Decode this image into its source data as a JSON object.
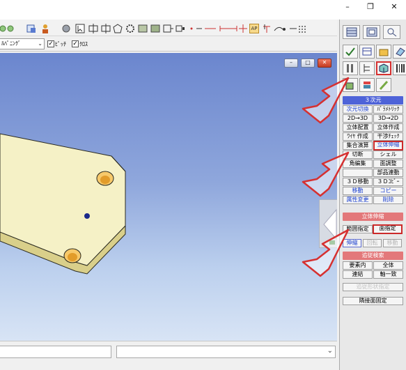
{
  "window": {
    "minimize": "–",
    "restore": "❐",
    "close": "✕"
  },
  "optionbar": {
    "combo_value": "ﾙﾊﾟﾆﾝｸﾞ",
    "check1_label": "ﾋﾟｯﾁ",
    "check2_label": "ｸﾛｽ"
  },
  "toolbar": {
    "ap_label": "AP"
  },
  "viewport": {
    "min_label": "–",
    "max_label": "□",
    "close_label": "✕"
  },
  "panel": {
    "section_3d": "３次元",
    "cmds_3d": [
      [
        "次元切換",
        "ﾊﾟﾗﾒﾄﾘｯｸ"
      ],
      [
        "2D→3D",
        "3D→2D"
      ],
      [
        "立体配置",
        "立体作成"
      ],
      [
        "ﾜｲﾔ 作成",
        "干渉ﾁｪｯｸ"
      ],
      [
        "集合演算",
        "立体伸縮"
      ],
      [
        "切断",
        "シェル"
      ],
      [
        "角編集",
        "面調整"
      ],
      [
        "",
        "部品連動"
      ],
      [
        "３Ｄ移動",
        "３Ｄｺﾋﾟｰ"
      ],
      [
        "移動",
        "コピー"
      ],
      [
        "属性変更",
        "削除"
      ]
    ],
    "section_stretch": "立体伸縮",
    "range_label": "範囲指定",
    "face_label": "面指定",
    "mode_labels": [
      "伸縮",
      "回転",
      "移動"
    ],
    "section_search": "追従検索",
    "search_labels": [
      "要素内",
      "全体"
    ],
    "link_labels": [
      "連結",
      "軸一致"
    ],
    "disabled_wide": "追従形状指定",
    "fixed_label": "隣接面固定"
  },
  "colors": {
    "accent_blue": "#4e63d8",
    "accent_red": "#e3787a",
    "highlight": "#d63030",
    "plate": "#f3efc2",
    "hole": "#e8a436"
  }
}
